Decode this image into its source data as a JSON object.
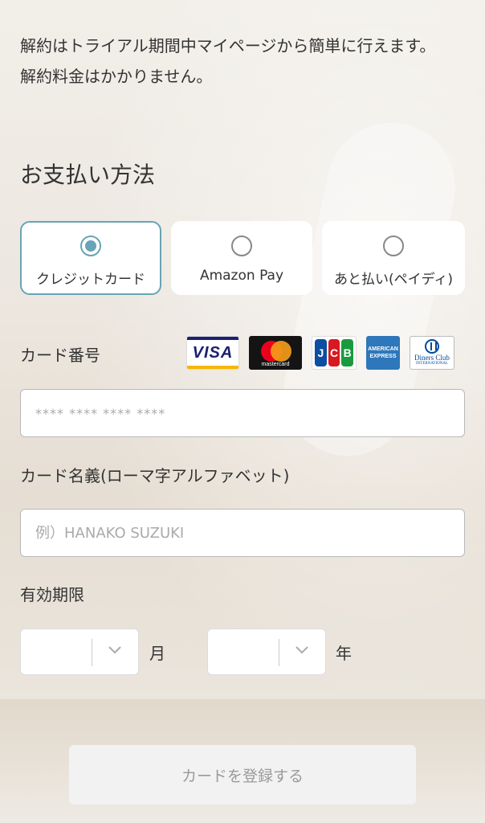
{
  "notice": {
    "line1": "解約はトライアル期間中マイページから簡単に行えます。",
    "line2": "解約料金はかかりません。"
  },
  "payment": {
    "title": "お支払い方法",
    "options": [
      {
        "label": "クレジットカード",
        "selected": true
      },
      {
        "label": "Amazon Pay",
        "selected": false
      },
      {
        "label": "あと払い(ペイディ)",
        "selected": false
      }
    ],
    "accent_color": "#67a4b5"
  },
  "card_number": {
    "label": "カード番号",
    "placeholder": "**** **** **** ****",
    "brands": [
      {
        "name": "VISA",
        "icon": "visa-logo"
      },
      {
        "name": "mastercard",
        "icon": "mastercard-logo"
      },
      {
        "name": "JCB",
        "icon": "jcb-logo"
      },
      {
        "name": "AMERICAN EXPRESS",
        "icon": "amex-logo"
      },
      {
        "name": "Diners Club INTERNATIONAL",
        "icon": "diners-club-logo"
      }
    ]
  },
  "card_name": {
    "label": "カード名義(ローマ字アルファベット)",
    "placeholder": "例）HANAKO SUZUKI"
  },
  "expiry": {
    "label": "有効期限",
    "month_unit": "月",
    "year_unit": "年"
  },
  "submit": {
    "label": "カードを登録する"
  }
}
